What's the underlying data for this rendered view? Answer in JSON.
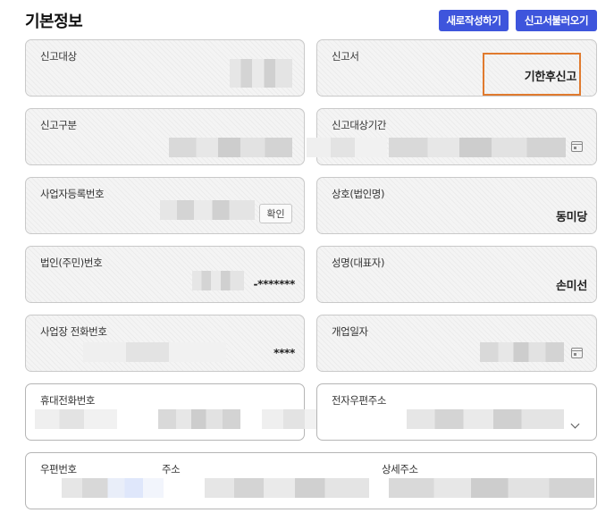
{
  "header": {
    "title": "기본정보",
    "new_button": "새로작성하기",
    "load_button": "신고서불러오기"
  },
  "fields": {
    "report_target": {
      "label": "신고대상"
    },
    "report_form": {
      "label": "신고서",
      "value": "기한후신고"
    },
    "report_type": {
      "label": "신고구분"
    },
    "report_period": {
      "label": "신고대상기간"
    },
    "biz_reg_no": {
      "label": "사업자등록번호",
      "check_label": "확인"
    },
    "company_name": {
      "label": "상호(법인명)",
      "value": "동미당"
    },
    "corp_no": {
      "label": "법인(주민)번호",
      "value_suffix": "-*******"
    },
    "representative": {
      "label": "성명(대표자)",
      "value": "손미선"
    },
    "biz_phone": {
      "label": "사업장 전화번호",
      "value_suffix": "****"
    },
    "open_date": {
      "label": "개업일자"
    },
    "mobile_phone": {
      "label": "휴대전화번호"
    },
    "email": {
      "label": "전자우편주소"
    },
    "address": {
      "zip_label": "우편번호",
      "address_label": "주소",
      "detail_label": "상세주소"
    }
  },
  "icons": {
    "calendar": "calendar-icon",
    "dropdown": "chevron-down-icon"
  },
  "colors": {
    "primary_button": "#3e55dc",
    "highlight_border": "#e07a2e",
    "readonly_bg": "#f4f4f4"
  }
}
